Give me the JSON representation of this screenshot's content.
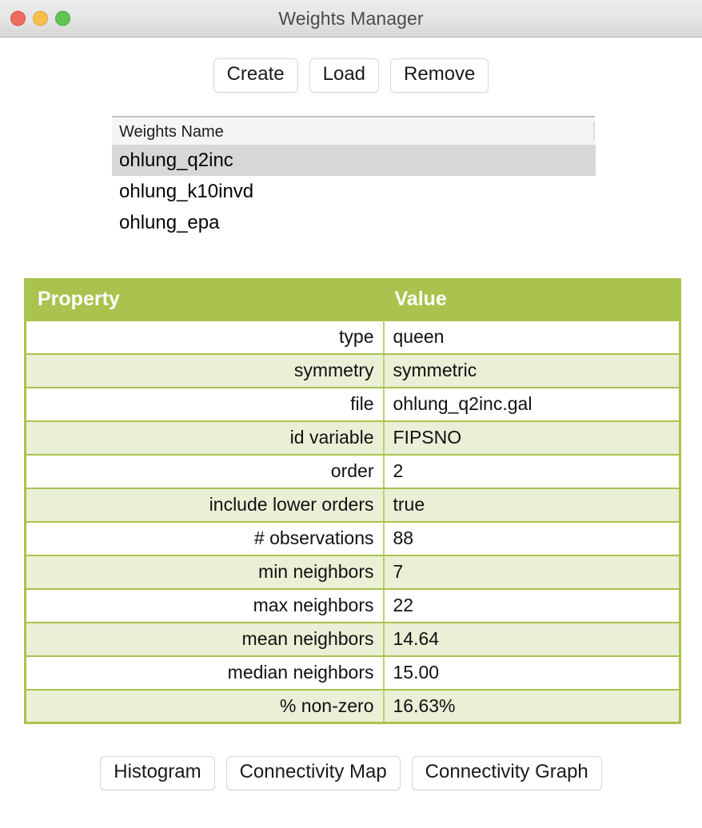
{
  "window": {
    "title": "Weights Manager",
    "traffic_lights": [
      {
        "name": "close",
        "color": "#ec6a5e"
      },
      {
        "name": "minimize",
        "color": "#f5bf4f"
      },
      {
        "name": "zoom",
        "color": "#61c555"
      }
    ]
  },
  "toolbar": {
    "create_label": "Create",
    "load_label": "Load",
    "remove_label": "Remove"
  },
  "weights_list": {
    "column_header": "Weights Name",
    "items": [
      {
        "name": "ohlung_q2inc",
        "selected": true
      },
      {
        "name": "ohlung_k10invd",
        "selected": false
      },
      {
        "name": "ohlung_epa",
        "selected": false
      }
    ]
  },
  "properties_table": {
    "headers": {
      "property": "Property",
      "value": "Value"
    },
    "header_bg": "#a9c34e",
    "alt_row_bg": "#eaf0d5",
    "rows": [
      {
        "property": "type",
        "value": "queen"
      },
      {
        "property": "symmetry",
        "value": "symmetric"
      },
      {
        "property": "file",
        "value": "ohlung_q2inc.gal"
      },
      {
        "property": "id variable",
        "value": "FIPSNO"
      },
      {
        "property": "order",
        "value": "2"
      },
      {
        "property": "include lower orders",
        "value": "true"
      },
      {
        "property": "# observations",
        "value": "88"
      },
      {
        "property": "min neighbors",
        "value": "7"
      },
      {
        "property": "max neighbors",
        "value": "22"
      },
      {
        "property": "mean neighbors",
        "value": "14.64"
      },
      {
        "property": "median neighbors",
        "value": "15.00"
      },
      {
        "property": "% non-zero",
        "value": "16.63%"
      }
    ]
  },
  "footer": {
    "histogram_label": "Histogram",
    "connectivity_map_label": "Connectivity Map",
    "connectivity_graph_label": "Connectivity Graph"
  }
}
